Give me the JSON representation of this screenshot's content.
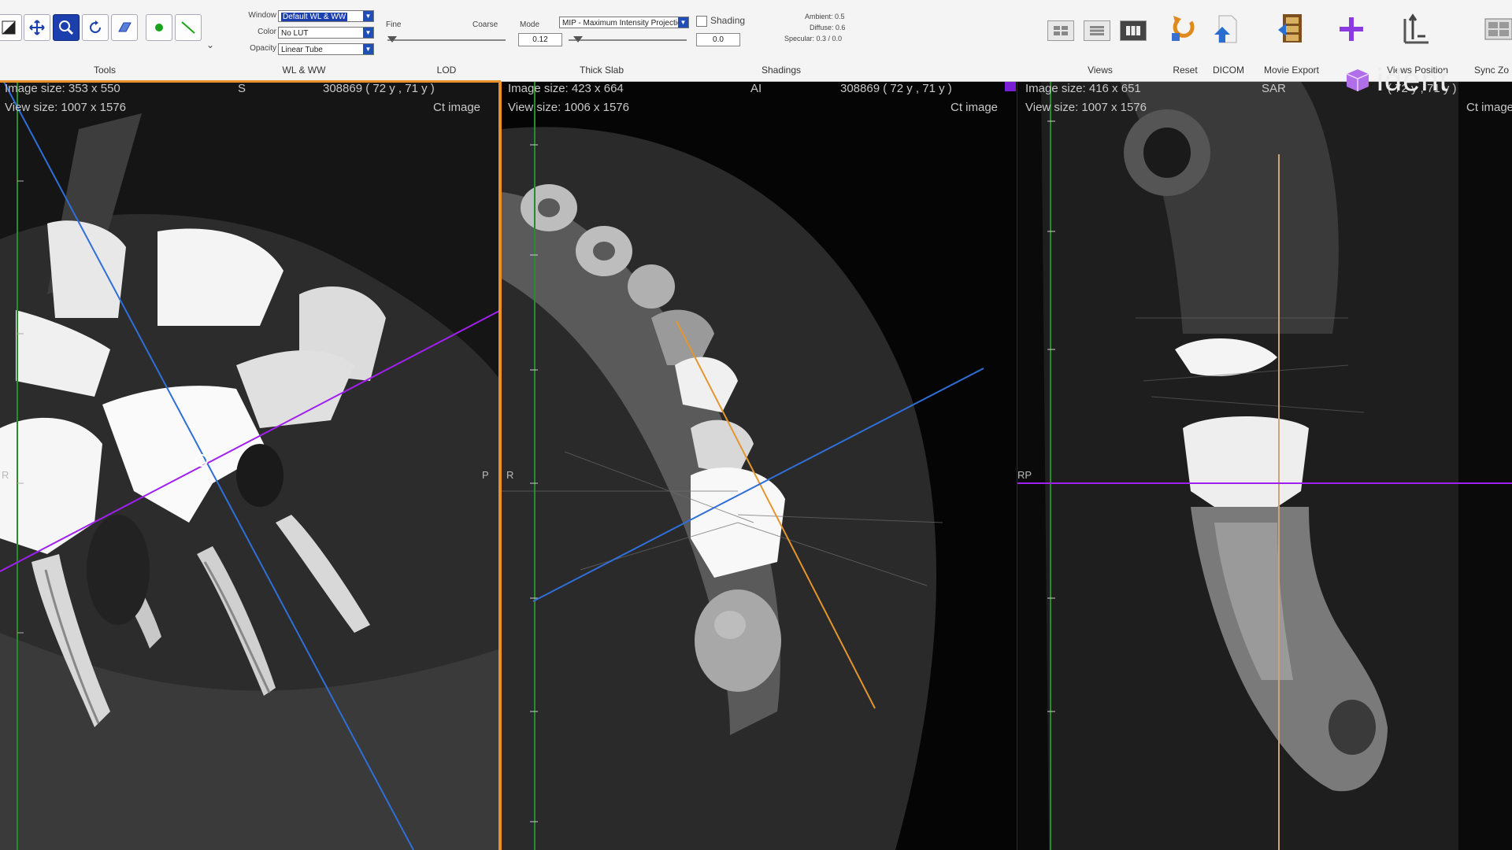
{
  "toolbar": {
    "groups": {
      "tools": "Tools",
      "wl_ww": "WL & WW",
      "lod": "LOD",
      "thick_slab": "Thick Slab",
      "shading": "Shadings",
      "views": "Views",
      "reset": "Reset",
      "dicom": "DICOM",
      "movie_export": "Movie Export",
      "add": "Add",
      "views_position": "Views Position",
      "sync_zoom": "Sync Zo"
    },
    "wl": {
      "window_label": "Window",
      "window_value": "Default WL & WW",
      "color_label": "Color",
      "color_value": "No LUT",
      "opacity_label": "Opacity",
      "opacity_value": "Linear Tube"
    },
    "lod": {
      "fine_label": "Fine",
      "coarse_label": "Coarse"
    },
    "slab": {
      "mode_label": "Mode",
      "mode_value": "MIP - Maximum Intensity Projection",
      "thickness_value": "0.12",
      "range_value": "0.0"
    },
    "shading": {
      "checkbox_label": "Shading",
      "checked": false,
      "ambient": "Ambient: 0.5",
      "diffuse": "Diffuse: 0.6",
      "specular": "Specular: 0.3 / 0.0"
    },
    "views": {
      "active_layout": 2
    }
  },
  "viewports": {
    "sagittal": {
      "image_size": "Image size: 353 x 550",
      "view_size": "View size: 1007 x 1576",
      "orientation": "S",
      "patient_info": "308869 ( 72 y , 71 y )",
      "modality": "Ct image",
      "left_letter": "R",
      "right_letter": "P"
    },
    "axial": {
      "image_size": "Image size: 423 x 664",
      "view_size": "View size: 1006 x 1576",
      "orientation": "AI",
      "patient_info": "308869 ( 72 y , 71 y )",
      "modality": "Ct image",
      "left_letter": "R"
    },
    "coronal": {
      "image_size": "Image size: 416 x 651",
      "view_size": "View size: 1007 x 1576",
      "orientation": "SAR",
      "patient_info": "( 72 y , 71 y )",
      "modality": "Ct image",
      "left_letter": "RP"
    }
  },
  "logo": {
    "text": "ident"
  },
  "colors": {
    "toolbar_bg": "#f4f4f4",
    "active_tool": "#1c3fae",
    "sagittal_border": "#e8902a",
    "axial_accent": "#7a1fd6",
    "blue_line": "#2f6fd8",
    "purple_line": "#a020f0",
    "orange_line": "#e3962e",
    "green_axis": "#2c8a2c"
  }
}
